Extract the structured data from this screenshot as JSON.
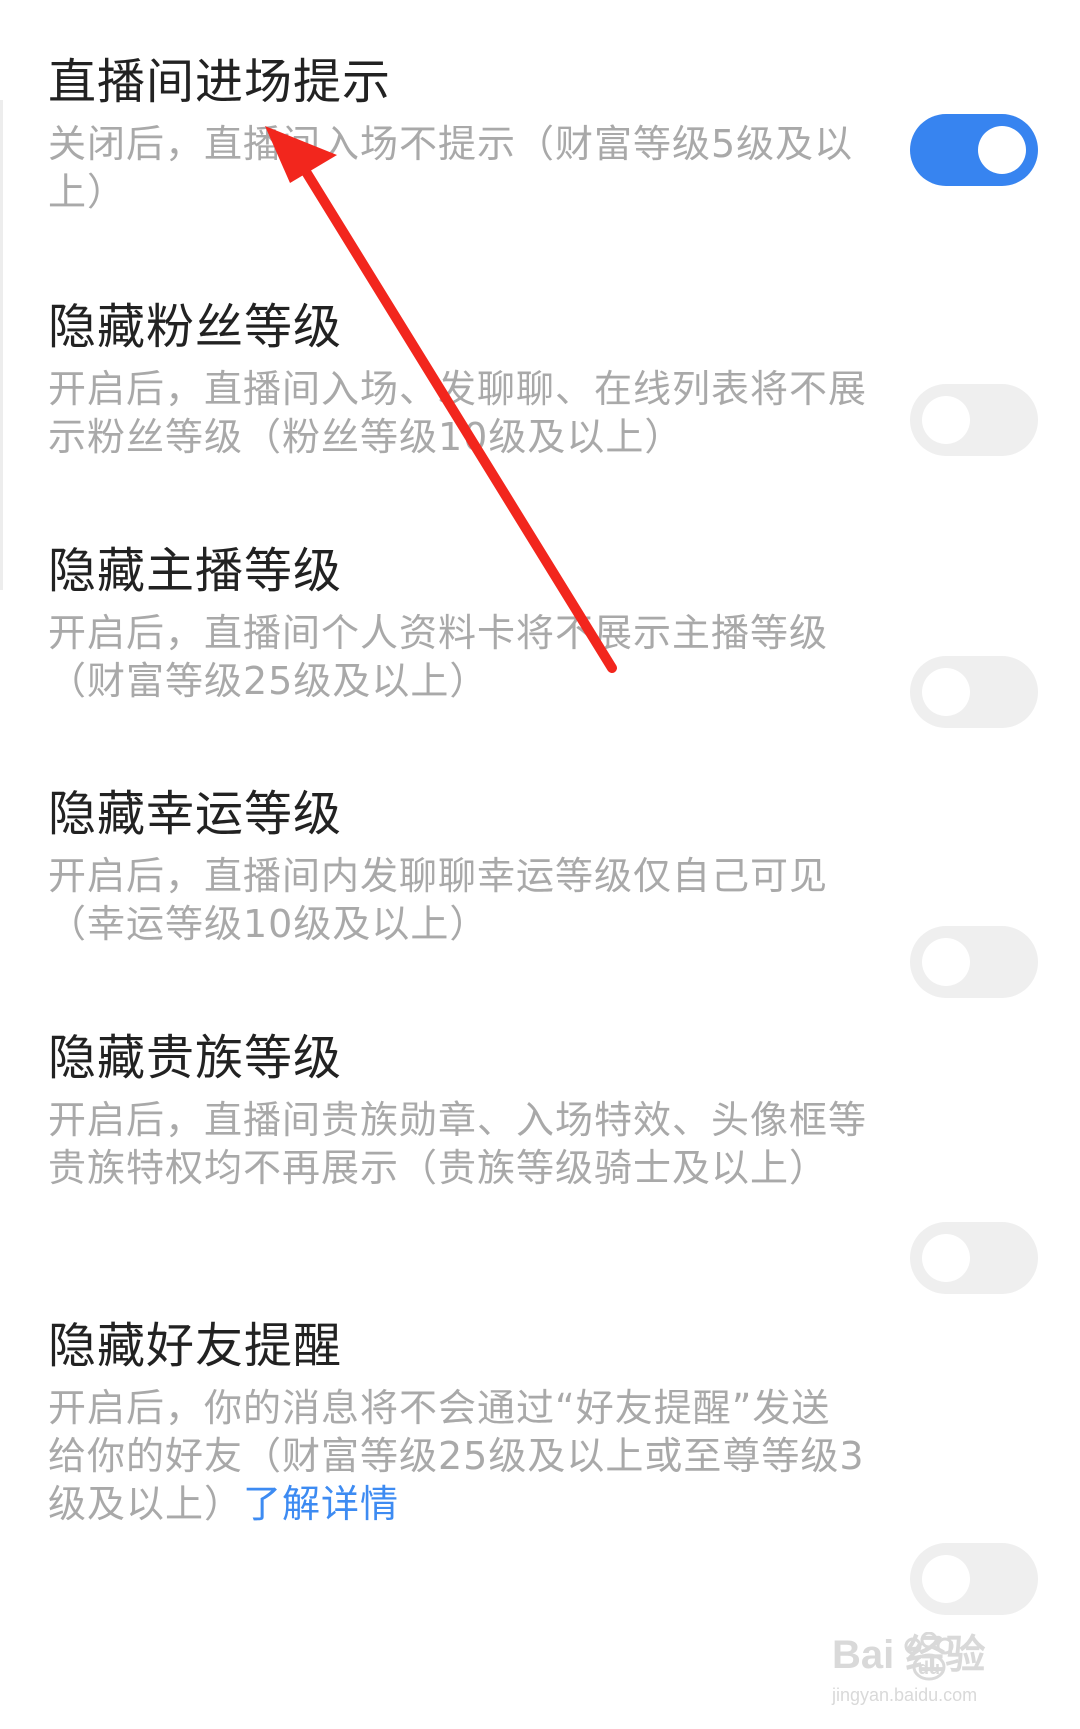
{
  "settings": [
    {
      "title": "直播间进场提示",
      "desc": "关闭后，直播间入场不提示（财富等级5级及以上）",
      "enabled": true
    },
    {
      "title": "隐藏粉丝等级",
      "desc": "开启后，直播间入场、发聊聊、在线列表将不展示粉丝等级（粉丝等级10级及以上）",
      "enabled": false
    },
    {
      "title": "隐藏主播等级",
      "desc": "开启后，直播间个人资料卡将不展示主播等级（财富等级25级及以上）",
      "enabled": false
    },
    {
      "title": "隐藏幸运等级",
      "desc": "开启后，直播间内发聊聊幸运等级仅自己可见（幸运等级10级及以上）",
      "enabled": false
    },
    {
      "title": "隐藏贵族等级",
      "desc": "开启后，直播间贵族勋章、入场特效、头像框等贵族特权均不再展示（贵族等级骑士及以上）",
      "enabled": false
    },
    {
      "title": "隐藏好友提醒",
      "desc": "开启后，你的消息将不会通过“好友提醒”发送给你的好友（财富等级25级及以上或至尊等级3级及以上）",
      "link": "了解详情",
      "enabled": false
    }
  ],
  "colors": {
    "toggle_on": "#3784f0",
    "toggle_off": "#efefef",
    "link": "#3d8bf2",
    "annotation_arrow": "#f2261d"
  },
  "watermark": {
    "brand": "Bai  经验",
    "url": "jingyan.baidu.com"
  }
}
